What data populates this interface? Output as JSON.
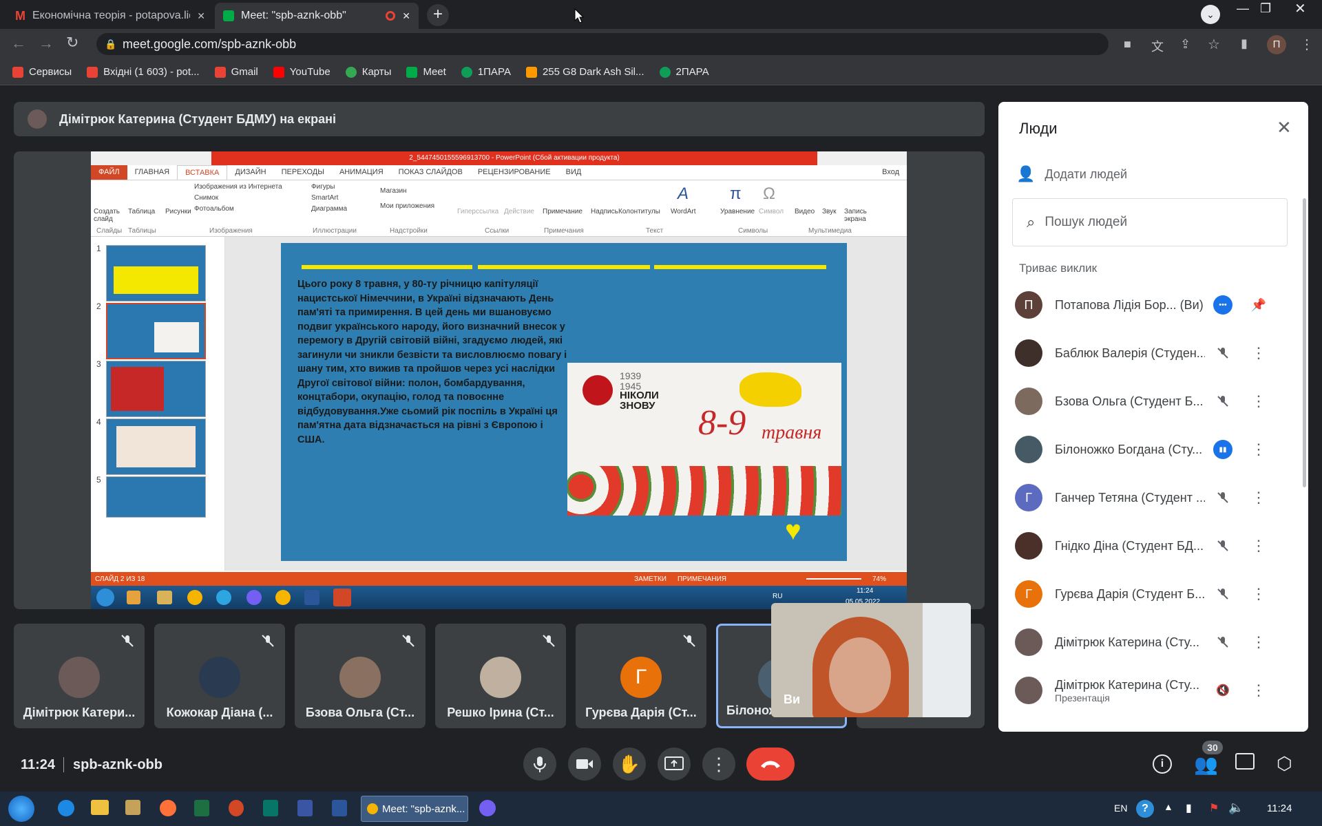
{
  "browser": {
    "tabs": [
      {
        "title": "Економічна теорія - potapova.lid",
        "close": "✕"
      },
      {
        "title": "Meet: \"spb-aznk-obb\"",
        "close": "✕"
      }
    ],
    "new_tab": "+",
    "url": "meet.google.com/spb-aznk-obb",
    "profile_initial": "П",
    "bookmarks": [
      "Сервисы",
      "Вхідні (1 603) - pot...",
      "Gmail",
      "YouTube",
      "Карты",
      "Meet",
      "1ПАРА",
      "255 G8 Dark Ash Sil...",
      "2ПАРА"
    ]
  },
  "presenting_banner": "Дімітрюк Катерина (Студент БДМУ) на екрані",
  "ppt": {
    "window_title": "2_5447450155596913700 - PowerPoint (Сбой активации продукта)",
    "menu": [
      "ФАЙЛ",
      "ГЛАВНАЯ",
      "ВСТАВКА",
      "ДИЗАЙН",
      "ПЕРЕХОДЫ",
      "АНИМАЦИЯ",
      "ПОКАЗ СЛАЙДОВ",
      "РЕЦЕНЗИРОВАНИЕ",
      "ВИД"
    ],
    "signin": "Вход",
    "ribbon_buttons": [
      "Создать слайд",
      "Таблица",
      "Рисунки",
      "Изображения из Интернета",
      "Снимок",
      "Фотоальбом",
      "Фигуры",
      "SmartArt",
      "Диаграмма",
      "Магазин",
      "Мои приложения",
      "Гиперссылка",
      "Действие",
      "Примечание",
      "Надпись",
      "Колонтитулы",
      "WordArt",
      "Уравнение",
      "Символ",
      "Видео",
      "Звук",
      "Запись экрана"
    ],
    "ribbon_groups": [
      "Слайды",
      "Таблицы",
      "Изображения",
      "Иллюстрации",
      "Надстройки",
      "Ссылки",
      "Примечания",
      "Текст",
      "Символы",
      "Мультимедиа"
    ],
    "thumb_numbers": [
      "1",
      "2",
      "3",
      "4",
      "5"
    ],
    "slide_text": "Цього року 8 травня, у 80-ту річницю капітуляції нацистської Німеччини, в Україні відзначають День пам'яті та примирення. В цей день ми вшановуємо подвиг українського народу, його визначний внесок у перемогу в Другій світовій війні, згадуємо людей, які загинули чи зникли безвісти та висловлюємо повагу і шану тим, хто вижив та пройшов через усі наслідки Другої світової війни: полон, бомбардування, концтабори, окупацію, голод та повоєнне відбудовування.Уже сьомий рік поспіль в Україні ця пам'ятна дата відзначається на рівні з Європою і США.",
    "poster_years": "1939\n1945",
    "poster_slogan": "НІКОЛИ\nЗНОВУ",
    "poster_date": "8-9",
    "poster_month": "травня",
    "status_slide": "СЛАЙД 2 ИЗ 18",
    "status_notes": "ЗАМЕТКИ",
    "status_comments": "ПРИМЕЧАНИЯ",
    "zoom": "74%",
    "taskbar_lang": "RU",
    "taskbar_time": "11:24",
    "taskbar_date": "05.05.2022"
  },
  "tiles": [
    {
      "name": "Дімітрюк Катери...",
      "avatar_color": "#6b5a58"
    },
    {
      "name": "Кожокар Діана (...",
      "avatar_color": "#2a3a50"
    },
    {
      "name": "Бзова Ольга (Ст...",
      "avatar_color": "#8a7060"
    },
    {
      "name": "Решко Ірина (Ст...",
      "avatar_color": "#c0b0a0"
    },
    {
      "name": "Гурєва Дарія (Ст...",
      "avatar_color": "#e8710a",
      "initial": "Г"
    },
    {
      "name": "Білоножко",
      "avatar_color": "#4a6070"
    }
  ],
  "self_label": "Ви",
  "meeting": {
    "time": "11:24",
    "code": "spb-aznk-obb",
    "participant_count": "30"
  },
  "people_panel": {
    "title": "Люди",
    "add_people": "Додати людей",
    "search_placeholder": "Пошук людей",
    "section": "Триває виклик",
    "participants": [
      {
        "name": "Потапова Лідія Бор...",
        "suffix": "(Ви)",
        "initial": "П",
        "color": "#5d4037",
        "state": "more"
      },
      {
        "name": "Баблюк Валерія (Студен...",
        "color": "#3e2f2a",
        "state": "muted"
      },
      {
        "name": "Бзова Ольга (Студент Б...",
        "color": "#7d6a5e",
        "state": "muted"
      },
      {
        "name": "Білоножко Богдана (Сту...",
        "color": "#455a64",
        "state": "speaking"
      },
      {
        "name": "Ганчер Тетяна (Студент ...",
        "initial": "Г",
        "color": "#5c6bc0",
        "state": "muted"
      },
      {
        "name": "Гнідко Діна (Студент БД...",
        "color": "#4a3028",
        "state": "muted"
      },
      {
        "name": "Гурєва Дарія (Студент Б...",
        "initial": "Г",
        "color": "#e8710a",
        "state": "muted"
      },
      {
        "name": "Дімітрюк Катерина (Сту...",
        "color": "#6b5a58",
        "state": "muted"
      },
      {
        "name": "Дімітрюк Катерина (Сту...",
        "sub": "Презентація",
        "color": "#6b5a58",
        "state": "presenting"
      }
    ]
  },
  "windows_taskbar": {
    "lang": "EN",
    "time": "11:24",
    "active_window": "Meet: \"spb-aznk..."
  }
}
